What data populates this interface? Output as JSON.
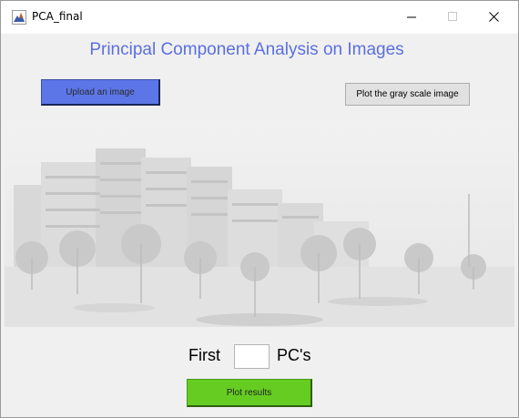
{
  "window": {
    "title": "PCA_final",
    "controls": [
      "minimize-icon",
      "maximize-icon",
      "close-icon"
    ]
  },
  "app": {
    "heading": "Principal Component Analysis on Images",
    "heading_color": "#5b6fe0"
  },
  "buttons": {
    "upload_label": "Upload an image",
    "upload_color": "#5c76e8",
    "gray_label": "Plot the gray scale image",
    "plot_label": "Plot results",
    "plot_color": "#66cc22"
  },
  "pc_control": {
    "prefix": "First",
    "value": "",
    "suffix": "PC's"
  },
  "image": {
    "description_icon": "grayscale-campus-photo"
  }
}
